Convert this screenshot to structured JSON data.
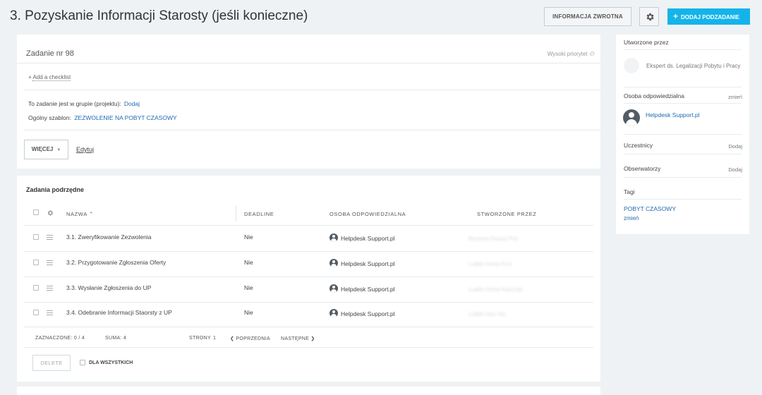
{
  "header": {
    "title": "3. Pozyskanie Informacji Starosty (jeśli konieczne)",
    "feedback_label": "INFORMACJA ZWROTNA",
    "add_subtask_label": "DODAJ PODZADANIE"
  },
  "task": {
    "number_label": "Zadanie nr 98",
    "priority_label": "Wysoki priorytet",
    "add_checklist_label": "Add a checklist",
    "group_label": "To zadanie jest w grupie (projektu):",
    "group_action": "Dodaj",
    "template_label": "Ogólny szablon:",
    "template_value": "ZEZWOLENIE NA POBYT CZASOWY",
    "more_label": "WIĘCEJ",
    "edit_label": "Edytuj"
  },
  "subtasks": {
    "title": "Zadania podrzędne",
    "columns": {
      "name": "NAZWA",
      "deadline": "DEADLINE",
      "responsible": "OSOBA ODPOWIEDZIALNA",
      "created_by": "STWORZONE PRZEZ"
    },
    "rows": [
      {
        "name": "3.1. Zweryfikowanie Zezwolenia",
        "deadline": "Nie",
        "responsible": "Helpdesk Support.pl",
        "created_by": "Bozena Kasza Pol"
      },
      {
        "name": "3.2. Przygotowanie Zgłoszenia Oferty",
        "deadline": "Nie",
        "responsible": "Helpdesk Support.pl",
        "created_by": "Lublin Anna Kos"
      },
      {
        "name": "3.3. Wysłanie Zgłoszenia do UP",
        "deadline": "Nie",
        "responsible": "Helpdesk Support.pl",
        "created_by": "Lublin Anna Kasznik"
      },
      {
        "name": "3.4. Odebranie Informacji Staorsty z UP",
        "deadline": "Nie",
        "responsible": "Helpdesk Support.pl",
        "created_by": "Lublin Ann Ka"
      }
    ],
    "footer": {
      "selected": "ZAZNACZONE: 0 / 4",
      "total": "SUMA: 4",
      "pages": "STRONY",
      "page_num": "1",
      "prev": "POPRZEDNIA",
      "next": "NASTĘPNE"
    },
    "delete_label": "DELETE",
    "for_all_label": "DLA WSZYSTKICH"
  },
  "sidebar": {
    "created_by_label": "Utworzone przez",
    "creator_role": "Ekspert ds. Legalizacji Pobytu i Pracy",
    "responsible_label": "Osoba odpowiedzialna",
    "responsible_action": "zmień",
    "responsible_name": "Helpdesk Support.pl",
    "participants_label": "Uczestnicy",
    "participants_action": "Dodaj",
    "observers_label": "Obserwatorzy",
    "observers_action": "Dodaj",
    "tags_label": "Tagi",
    "tag_value": "POBYT CZASOWY",
    "tag_action": "zmień"
  },
  "colors": {
    "accent": "#14b4ea",
    "link": "#1f6bb0",
    "background": "#eef2f4"
  }
}
